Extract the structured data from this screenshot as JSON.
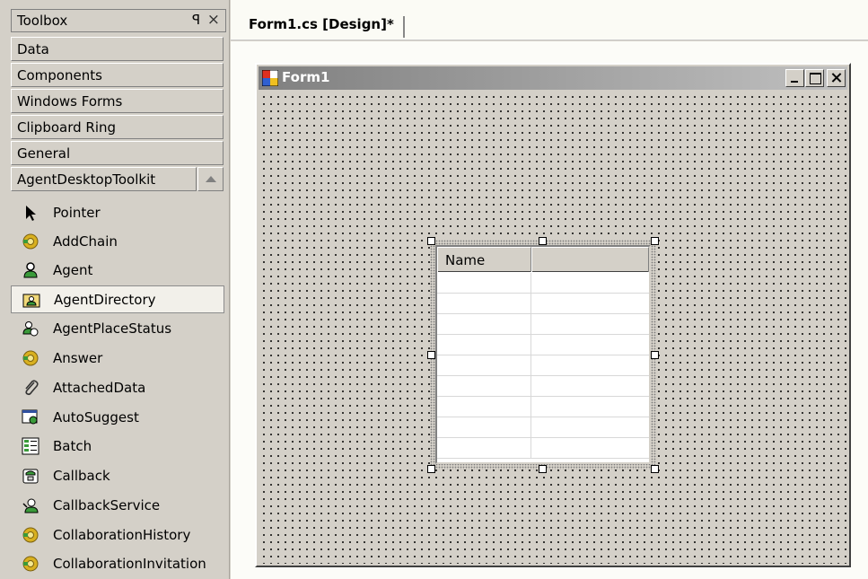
{
  "toolbox": {
    "title": "Toolbox",
    "pin_glyph": "ꟼ",
    "close_glyph": "×",
    "categories": [
      "Data",
      "Components",
      "Windows Forms",
      "Clipboard Ring",
      "General",
      "AgentDesktopToolkit"
    ],
    "tools": [
      {
        "label": "Pointer",
        "icon": "pointer-icon"
      },
      {
        "label": "AddChain",
        "icon": "gear-component-icon"
      },
      {
        "label": "Agent",
        "icon": "agent-icon"
      },
      {
        "label": "AgentDirectory",
        "icon": "agent-directory-icon"
      },
      {
        "label": "AgentPlaceStatus",
        "icon": "agent-place-status-icon"
      },
      {
        "label": "Answer",
        "icon": "gear-component-icon"
      },
      {
        "label": "AttachedData",
        "icon": "paperclip-icon"
      },
      {
        "label": "AutoSuggest",
        "icon": "autosuggest-icon"
      },
      {
        "label": "Batch",
        "icon": "batch-icon"
      },
      {
        "label": "Callback",
        "icon": "callback-icon"
      },
      {
        "label": "CallbackService",
        "icon": "callback-service-icon"
      },
      {
        "label": "CollaborationHistory",
        "icon": "gear-component-icon"
      },
      {
        "label": "CollaborationInvitation",
        "icon": "gear-component-icon"
      }
    ],
    "selected_tool": "AgentDirectory"
  },
  "document": {
    "tab_label": "Form1.cs [Design]*"
  },
  "form": {
    "title": "Form1",
    "grid": {
      "columns": [
        "Name",
        ""
      ],
      "row_count": 9
    }
  },
  "colors": {
    "chrome": "#d4d0c8",
    "titlebar_start": "#808080",
    "titlebar_end": "#c0c0c0"
  }
}
